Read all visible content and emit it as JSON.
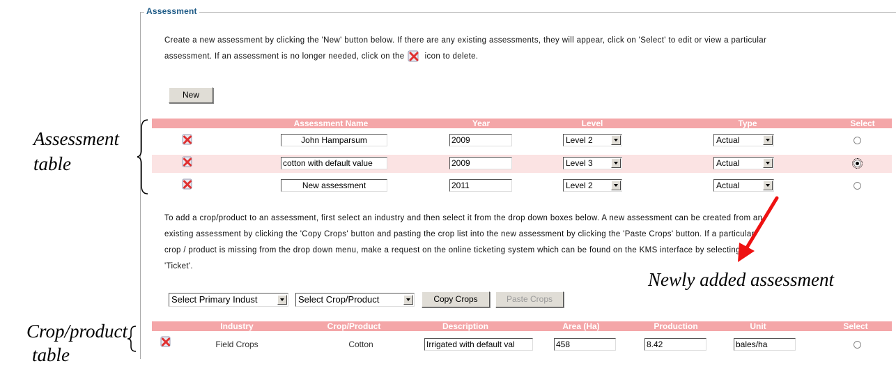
{
  "section": {
    "legend": "Assessment"
  },
  "intro": {
    "line1": "Create a new assessment by clicking the 'New' button below. If there are any existing assessments, they will appear, click on 'Select' to edit or view a particular",
    "line2a": "assessment. If an assessment is no longer needed, click on the",
    "line2b": "icon to delete."
  },
  "new_button": "New",
  "assessment_table": {
    "headers": [
      "Assessment Name",
      "Year",
      "Level",
      "Type",
      "Select"
    ],
    "rows": [
      {
        "name": "John Hamparsum",
        "year": "2009",
        "level": "Level 2",
        "type": "Actual",
        "selected": false
      },
      {
        "name": "cotton with default value",
        "year": "2009",
        "level": "Level 3",
        "type": "Actual",
        "selected": true
      },
      {
        "name": "New assessment",
        "year": "2011",
        "level": "Level 2",
        "type": "Actual",
        "selected": false
      }
    ]
  },
  "crop_intro": {
    "line1": "To add a crop/product to an assessment, first select an industry and then select it from the drop down boxes below. A new assessment can be created from an",
    "line2": "existing assessment by clicking the 'Copy Crops' button and pasting the crop list into the new assessment by clicking the 'Paste Crops' button. If a particular",
    "line3": "crop / product is missing from the drop down menu, make a request on the online ticketing system which can be found on the KMS interface by selecting",
    "line4": "'Ticket'."
  },
  "crop_controls": {
    "industry_select": "Select Primary Indust",
    "crop_select": "Select Crop/Product",
    "copy_button": "Copy Crops",
    "paste_button": "Paste Crops"
  },
  "crop_table": {
    "headers": [
      "Industry",
      "Crop/Product",
      "Description",
      "Area (Ha)",
      "Production",
      "Unit",
      "Select"
    ],
    "rows": [
      {
        "industry": "Field Crops",
        "crop": "Cotton",
        "description": "Irrigated with default val",
        "area": "458",
        "production": "8.42",
        "unit": "bales/ha",
        "selected": false
      }
    ]
  },
  "annotations": {
    "assessment_table": [
      "Assessment",
      "table"
    ],
    "newly_added": "Newly added assessment",
    "crop_table": [
      "Crop/product",
      "table"
    ]
  },
  "colors": {
    "header_bg": "#f4a6a8",
    "row_highlight": "#fbe3e3",
    "legend": "#1d5a86",
    "arrow": "#ee1111"
  }
}
